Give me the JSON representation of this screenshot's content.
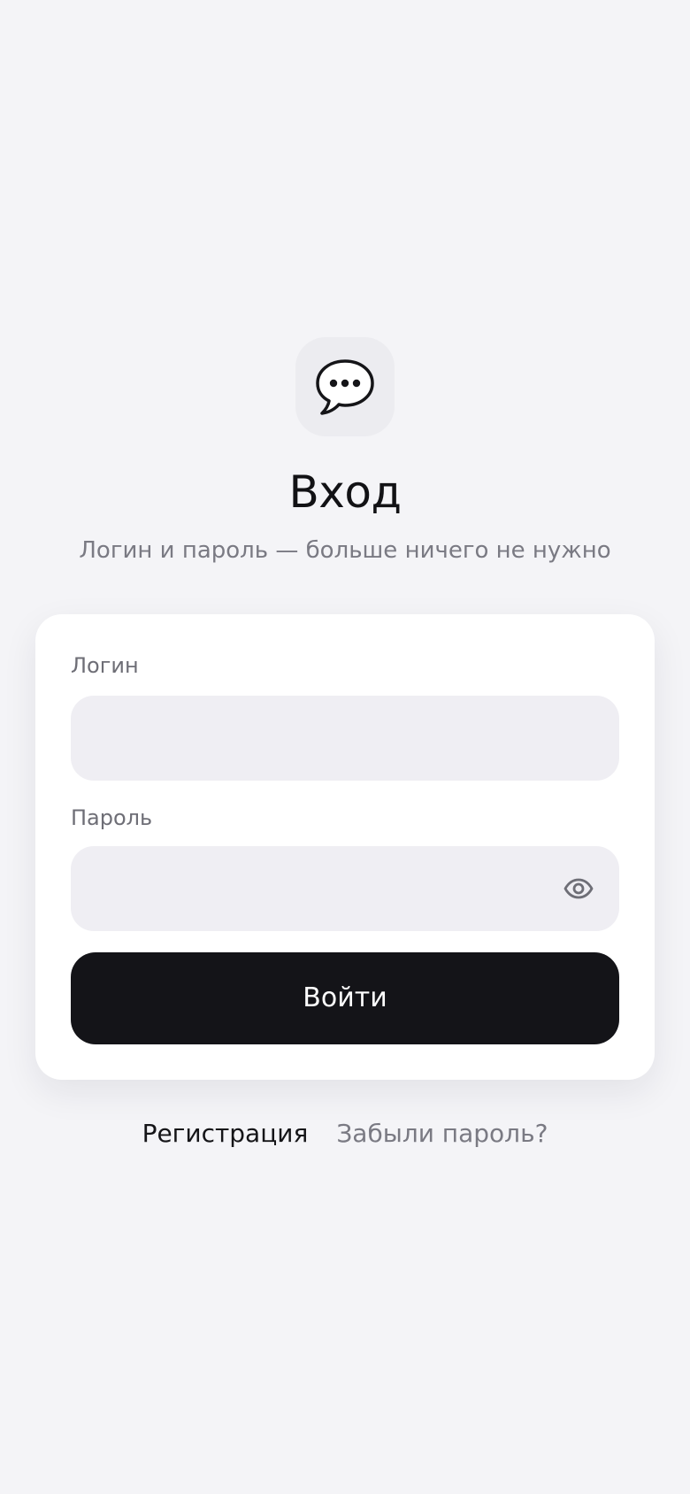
{
  "header": {
    "icon": "chat-bubble-icon",
    "title": "Вход",
    "subtitle": "Логин и пароль — больше ничего не нужно"
  },
  "form": {
    "login_label": "Логин",
    "login_value": "",
    "password_label": "Пароль",
    "password_value": "",
    "password_toggle_icon": "eye-icon",
    "submit_label": "Войти"
  },
  "footer": {
    "register_label": "Регистрация",
    "forgot_label": "Забыли пароль?"
  }
}
